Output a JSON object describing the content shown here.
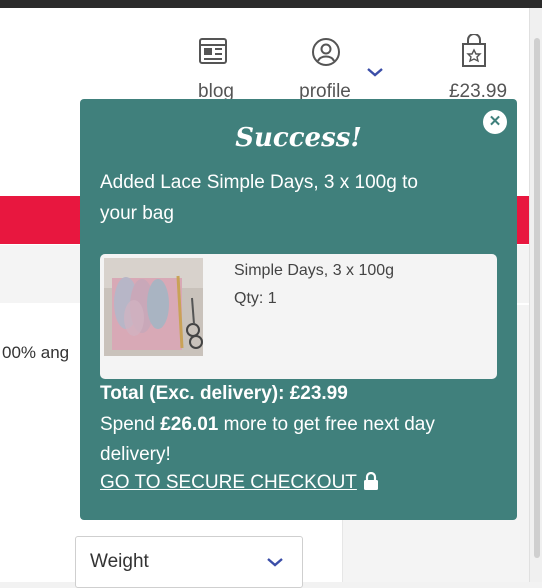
{
  "header": {
    "nav": [
      {
        "label": "blog",
        "icon": "blog-icon"
      },
      {
        "label": "profile",
        "icon": "profile-icon"
      },
      {
        "label": "£23.99",
        "icon": "bag-icon"
      }
    ]
  },
  "page": {
    "partial_text": "00% ang",
    "weight_select": {
      "value": "Weight",
      "icon": "chevron-down-icon"
    }
  },
  "popup": {
    "title": "Success!",
    "close_icon": "close-icon",
    "message": "Added Lace Simple Days, 3 x 100g to your bag",
    "product": {
      "name": "Simple Days, 3 x 100g",
      "qty": "Qty: 1",
      "image": "yarn-product-image"
    },
    "total": "Total (Exc. delivery): £23.99",
    "spend_prefix": "Spend ",
    "spend_amount": "£26.01",
    "spend_suffix": " more to get free next day delivery!",
    "checkout_label": "GO TO SECURE CHECKOUT",
    "checkout_icon": "lock-icon"
  },
  "colors": {
    "popup_bg": "#40807c",
    "red_bar": "#e8173f",
    "chevron": "#3b4ea8"
  }
}
